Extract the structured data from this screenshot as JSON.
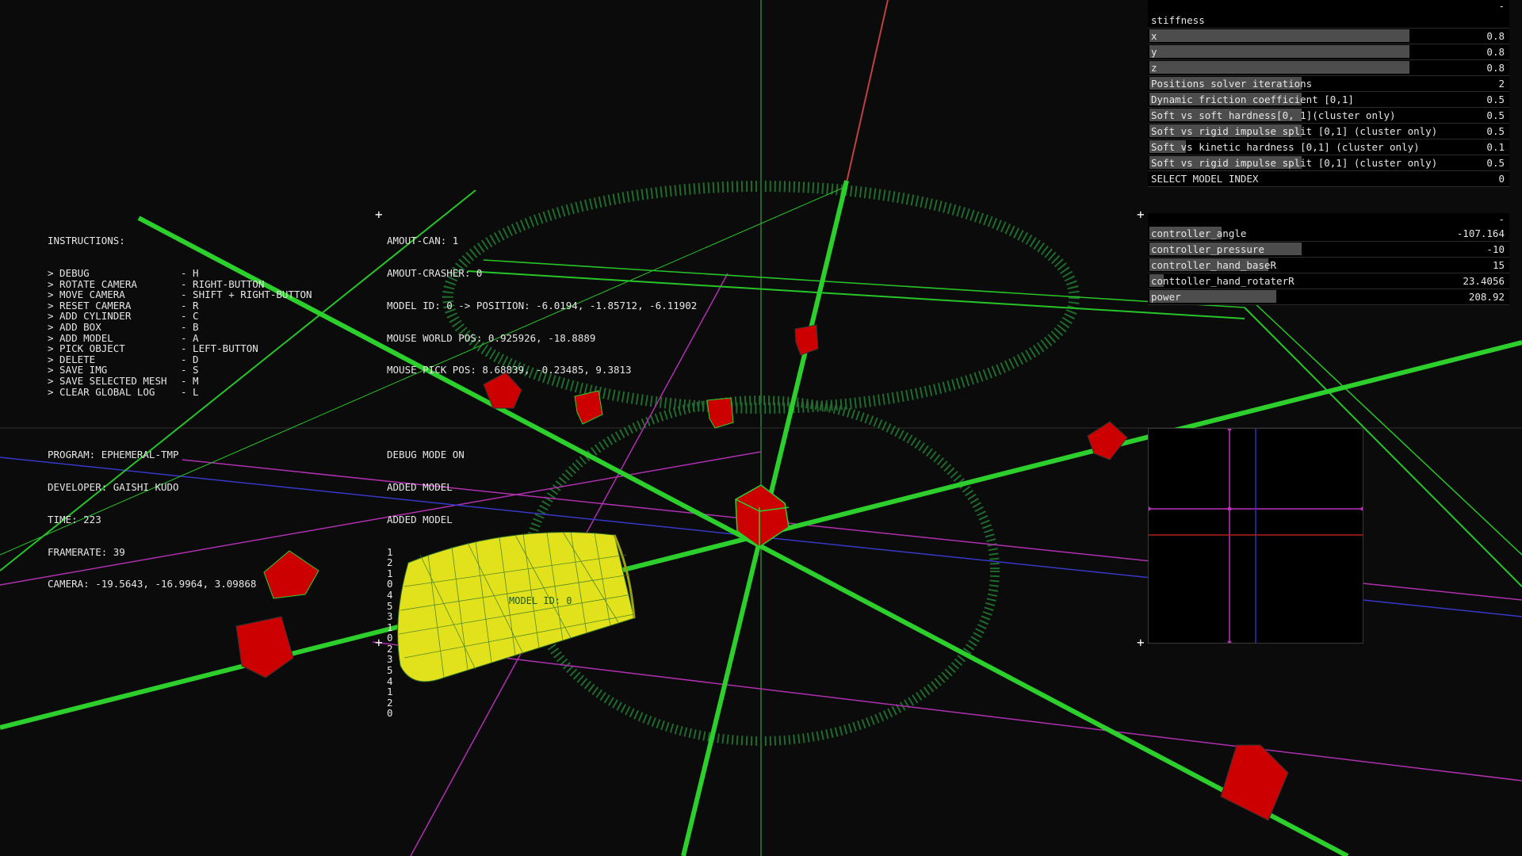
{
  "scene": {
    "center_label": "MODEL ID: 0"
  },
  "instructions": {
    "title": "INSTRUCTIONS:",
    "items": [
      {
        "label": "> DEBUG",
        "key": "- H"
      },
      {
        "label": "> ROTATE CAMERA",
        "key": "- RIGHT-BUTTON"
      },
      {
        "label": "> MOVE CAMERA",
        "key": "- SHIFT + RIGHT-BUTTON"
      },
      {
        "label": "> RESET CAMERA",
        "key": "- R"
      },
      {
        "label": "> ADD CYLINDER",
        "key": "- C"
      },
      {
        "label": "> ADD BOX",
        "key": "- B"
      },
      {
        "label": "> ADD MODEL",
        "key": "- A"
      },
      {
        "label": "> PICK OBJECT",
        "key": "- LEFT-BUTTON"
      },
      {
        "label": "> DELETE",
        "key": "- D"
      },
      {
        "label": "> SAVE IMG",
        "key": "- S"
      },
      {
        "label": "> SAVE SELECTED MESH",
        "key": "- M"
      },
      {
        "label": "> CLEAR GLOBAL LOG",
        "key": "- L"
      }
    ]
  },
  "stats": {
    "amout_can": "AMOUT-CAN: 1",
    "amout_crasher": "AMOUT-CRASHER: 0",
    "model_pos": "MODEL ID: 0 -> POSITION: -6.0194, -1.85712, -6.11902",
    "mouse_world": "MOUSE WORLD POS: 0.925926, -18.8889",
    "mouse_pick": "MOUSE PICK POS: 8.68839, -0.23485, 9.3813"
  },
  "program": {
    "program": "PROGRAM: EPHEMERAL-TMP",
    "developer": "DEVELOPER: GAISHI KUDO",
    "time": "TIME: 223",
    "framerate": "FRAMERATE: 39",
    "camera": "CAMERA: -19.5643, -16.9964, 3.09868"
  },
  "log": {
    "debug": "DEBUG MODE ON",
    "added1": "ADDED MODEL",
    "added2": "ADDED MODEL",
    "numbers": [
      "1",
      "2",
      "1",
      "0",
      "4",
      "5",
      "3",
      "1",
      "0",
      "2",
      "3",
      "5",
      "4",
      "1",
      "2",
      "0"
    ]
  },
  "params_panel": {
    "collapse": "-",
    "header": "stiffness",
    "rows": [
      {
        "label": "x",
        "value": "0.8",
        "fill": 0.72
      },
      {
        "label": "y",
        "value": "0.8",
        "fill": 0.72
      },
      {
        "label": "z",
        "value": "0.8",
        "fill": 0.72
      },
      {
        "label": "Positions solver iterations",
        "value": "2",
        "fill": 0.42
      },
      {
        "label": "Dynamic friction coefficient [0,1]",
        "value": "0.5",
        "fill": 0.42
      },
      {
        "label": "Soft vs soft hardness[0, 1](cluster only)",
        "value": "0.5",
        "fill": 0.42
      },
      {
        "label": "Soft vs rigid impulse split [0,1] (cluster only)",
        "value": "0.5",
        "fill": 0.42
      },
      {
        "label": "Soft vs kinetic hardness [0,1] (cluster only)",
        "value": "0.1",
        "fill": 0.1
      },
      {
        "label": "Soft vs rigid impulse split [0,1] (cluster only)",
        "value": "0.5",
        "fill": 0.42
      }
    ],
    "select_label": "SELECT MODEL INDEX",
    "select_value": "0"
  },
  "controller_panel": {
    "collapse": "-",
    "rows": [
      {
        "label": "controller_angle",
        "value": "-107.164",
        "fill": 0.2
      },
      {
        "label": "controller_pressure",
        "value": "-10",
        "fill": 0.42
      },
      {
        "label": "controller_hand_baseR",
        "value": "15",
        "fill": 0.33
      },
      {
        "label": "conttoller_hand_rotaterR",
        "value": "23.4056",
        "fill": 0.04
      },
      {
        "label": "power",
        "value": "208.92",
        "fill": 0.35
      }
    ]
  },
  "colors": {
    "background": "#0b0b0b",
    "grid_green": "#1f7a2e",
    "axis_green": "#27d127",
    "box_red": "#cc0000",
    "mesh_yellow": "#e8e820",
    "magenta": "#c030c0",
    "blue": "#3030c0"
  }
}
